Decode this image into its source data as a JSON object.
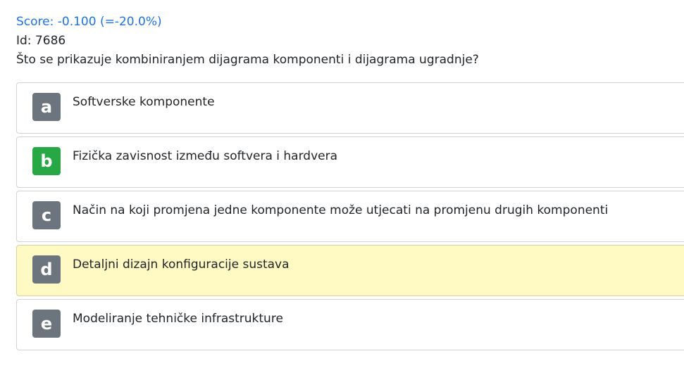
{
  "score": "Score: -0.100 (=-20.0%)",
  "id": "Id: 7686",
  "question": "Što se prikazuje kombiniranjem dijagrama komponenti i dijagrama ugradnje?",
  "colors": {
    "score": "#1a73e8",
    "letter_default": "#6c757d",
    "letter_correct": "#28a745",
    "selected_bg": "#fff9c4"
  },
  "answers": [
    {
      "letter": "a",
      "text": "Softverske komponente",
      "state": "default"
    },
    {
      "letter": "b",
      "text": "Fizička zavisnost između softvera i hardvera",
      "state": "correct"
    },
    {
      "letter": "c",
      "text": "Način na koji promjena jedne komponente može utjecati na promjenu drugih komponenti",
      "state": "default"
    },
    {
      "letter": "d",
      "text": "Detaljni dizajn konfiguracije sustava",
      "state": "selected"
    },
    {
      "letter": "e",
      "text": "Modeliranje tehničke infrastrukture",
      "state": "default"
    }
  ]
}
